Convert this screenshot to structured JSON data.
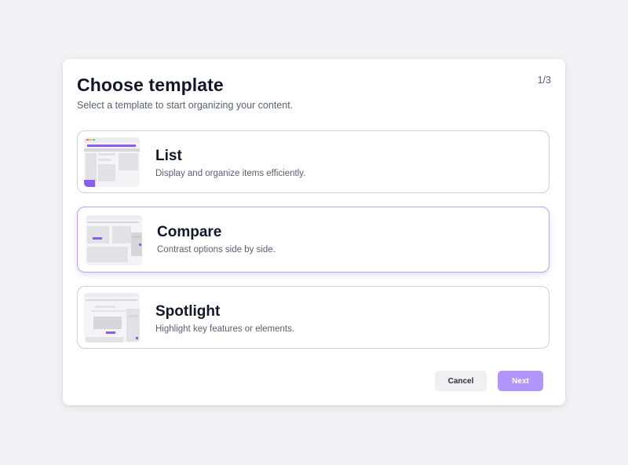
{
  "dialog": {
    "title": "Choose template",
    "subtitle": "Select a template to start organizing your content.",
    "step": "1/3"
  },
  "templates": [
    {
      "name": "List",
      "description": "Display and organize items efficiently.",
      "selected": false
    },
    {
      "name": "Compare",
      "description": "Contrast options side by side.",
      "selected": true
    },
    {
      "name": "Spotlight",
      "description": "Highlight key features or elements.",
      "selected": false
    }
  ],
  "buttons": {
    "cancel": "Cancel",
    "next": "Next"
  },
  "colors": {
    "accent": "#8a5cf0",
    "next_button": "#b295fb",
    "selected_border": "#b8a3f5",
    "title_text": "#12172b"
  }
}
